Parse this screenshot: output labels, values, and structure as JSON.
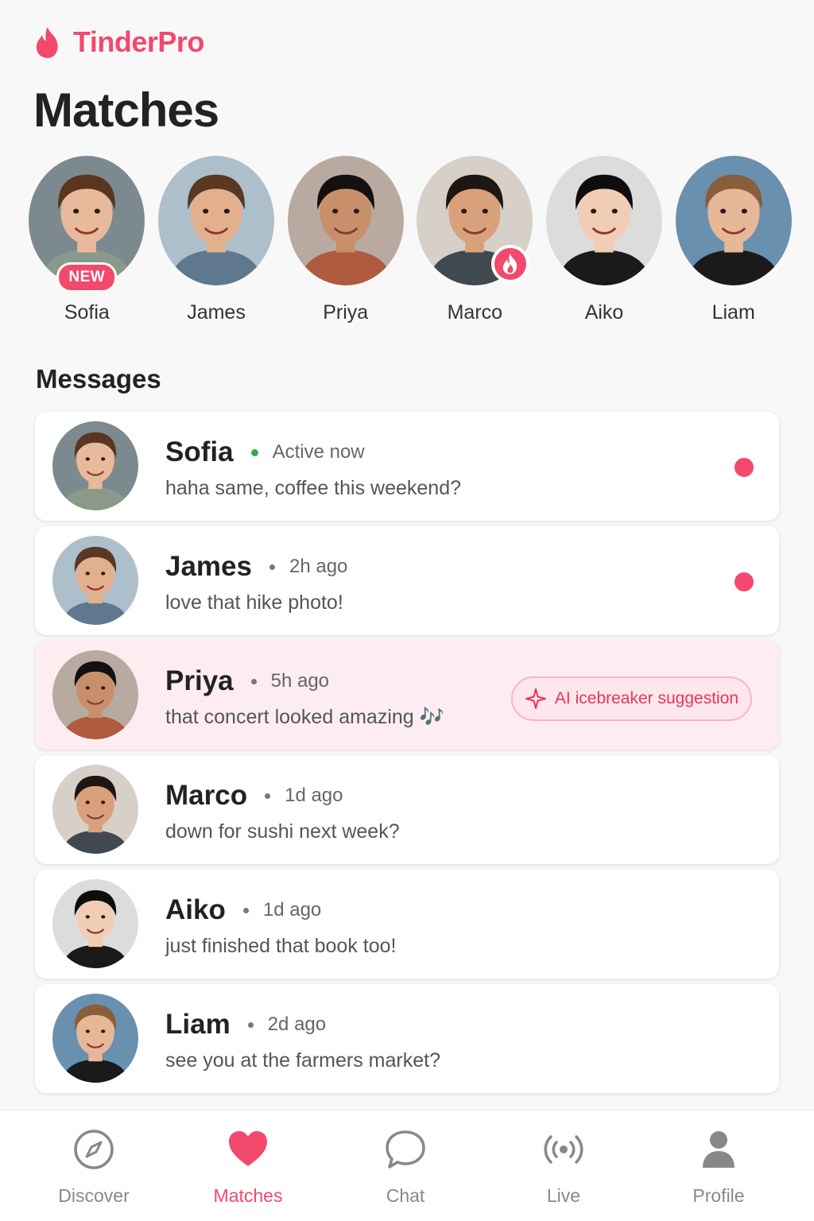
{
  "app": {
    "name": "TinderPro",
    "accent": "#f2496d"
  },
  "page": {
    "title": "Matches"
  },
  "matches": [
    {
      "name": "Sofia",
      "badge": "NEW",
      "skin": "#e8b99a",
      "hair": "#5a3520",
      "shirt": "#8a9a8a",
      "bg": "#7c8a90"
    },
    {
      "name": "James",
      "skin": "#e3b08e",
      "hair": "#5a3822",
      "shirt": "#5f7890",
      "bg": "#aebfcc"
    },
    {
      "name": "Priya",
      "skin": "#c8906a",
      "hair": "#141010",
      "shirt": "#b05a40",
      "bg": "#b8aaa0"
    },
    {
      "name": "Marco",
      "flame": true,
      "skin": "#d9a07c",
      "hair": "#1e1612",
      "shirt": "#404850",
      "bg": "#d6d0c8"
    },
    {
      "name": "Aiko",
      "skin": "#f0cdb4",
      "hair": "#0e0c0c",
      "shirt": "#1a1a1a",
      "bg": "#dcdcdc"
    },
    {
      "name": "Liam",
      "skin": "#e6b898",
      "hair": "#8a5e3a",
      "shirt": "#1a1a1a",
      "bg": "#6a90b0"
    }
  ],
  "messages_section": {
    "title": "Messages"
  },
  "messages": [
    {
      "name": "Sofia",
      "time": "Active now",
      "active": true,
      "preview": "haha same, coffee this weekend?",
      "unread": true
    },
    {
      "name": "James",
      "time": "2h ago",
      "preview": "love that hike photo!",
      "unread": true
    },
    {
      "name": "Priya",
      "time": "5h ago",
      "preview": "that concert looked amazing 🎶",
      "highlight": true,
      "ai_chip": "AI icebreaker suggestion"
    },
    {
      "name": "Marco",
      "time": "1d ago",
      "preview": "down for sushi next week?"
    },
    {
      "name": "Aiko",
      "time": "1d ago",
      "preview": "just finished that book too!"
    },
    {
      "name": "Liam",
      "time": "2d ago",
      "preview": "see you at the farmers market?"
    }
  ],
  "nav": [
    {
      "label": "Discover",
      "icon": "compass-icon"
    },
    {
      "label": "Matches",
      "icon": "heart-icon",
      "active": true
    },
    {
      "label": "Chat",
      "icon": "chat-bubble-icon"
    },
    {
      "label": "Live",
      "icon": "broadcast-icon"
    },
    {
      "label": "Profile",
      "icon": "person-icon"
    }
  ]
}
